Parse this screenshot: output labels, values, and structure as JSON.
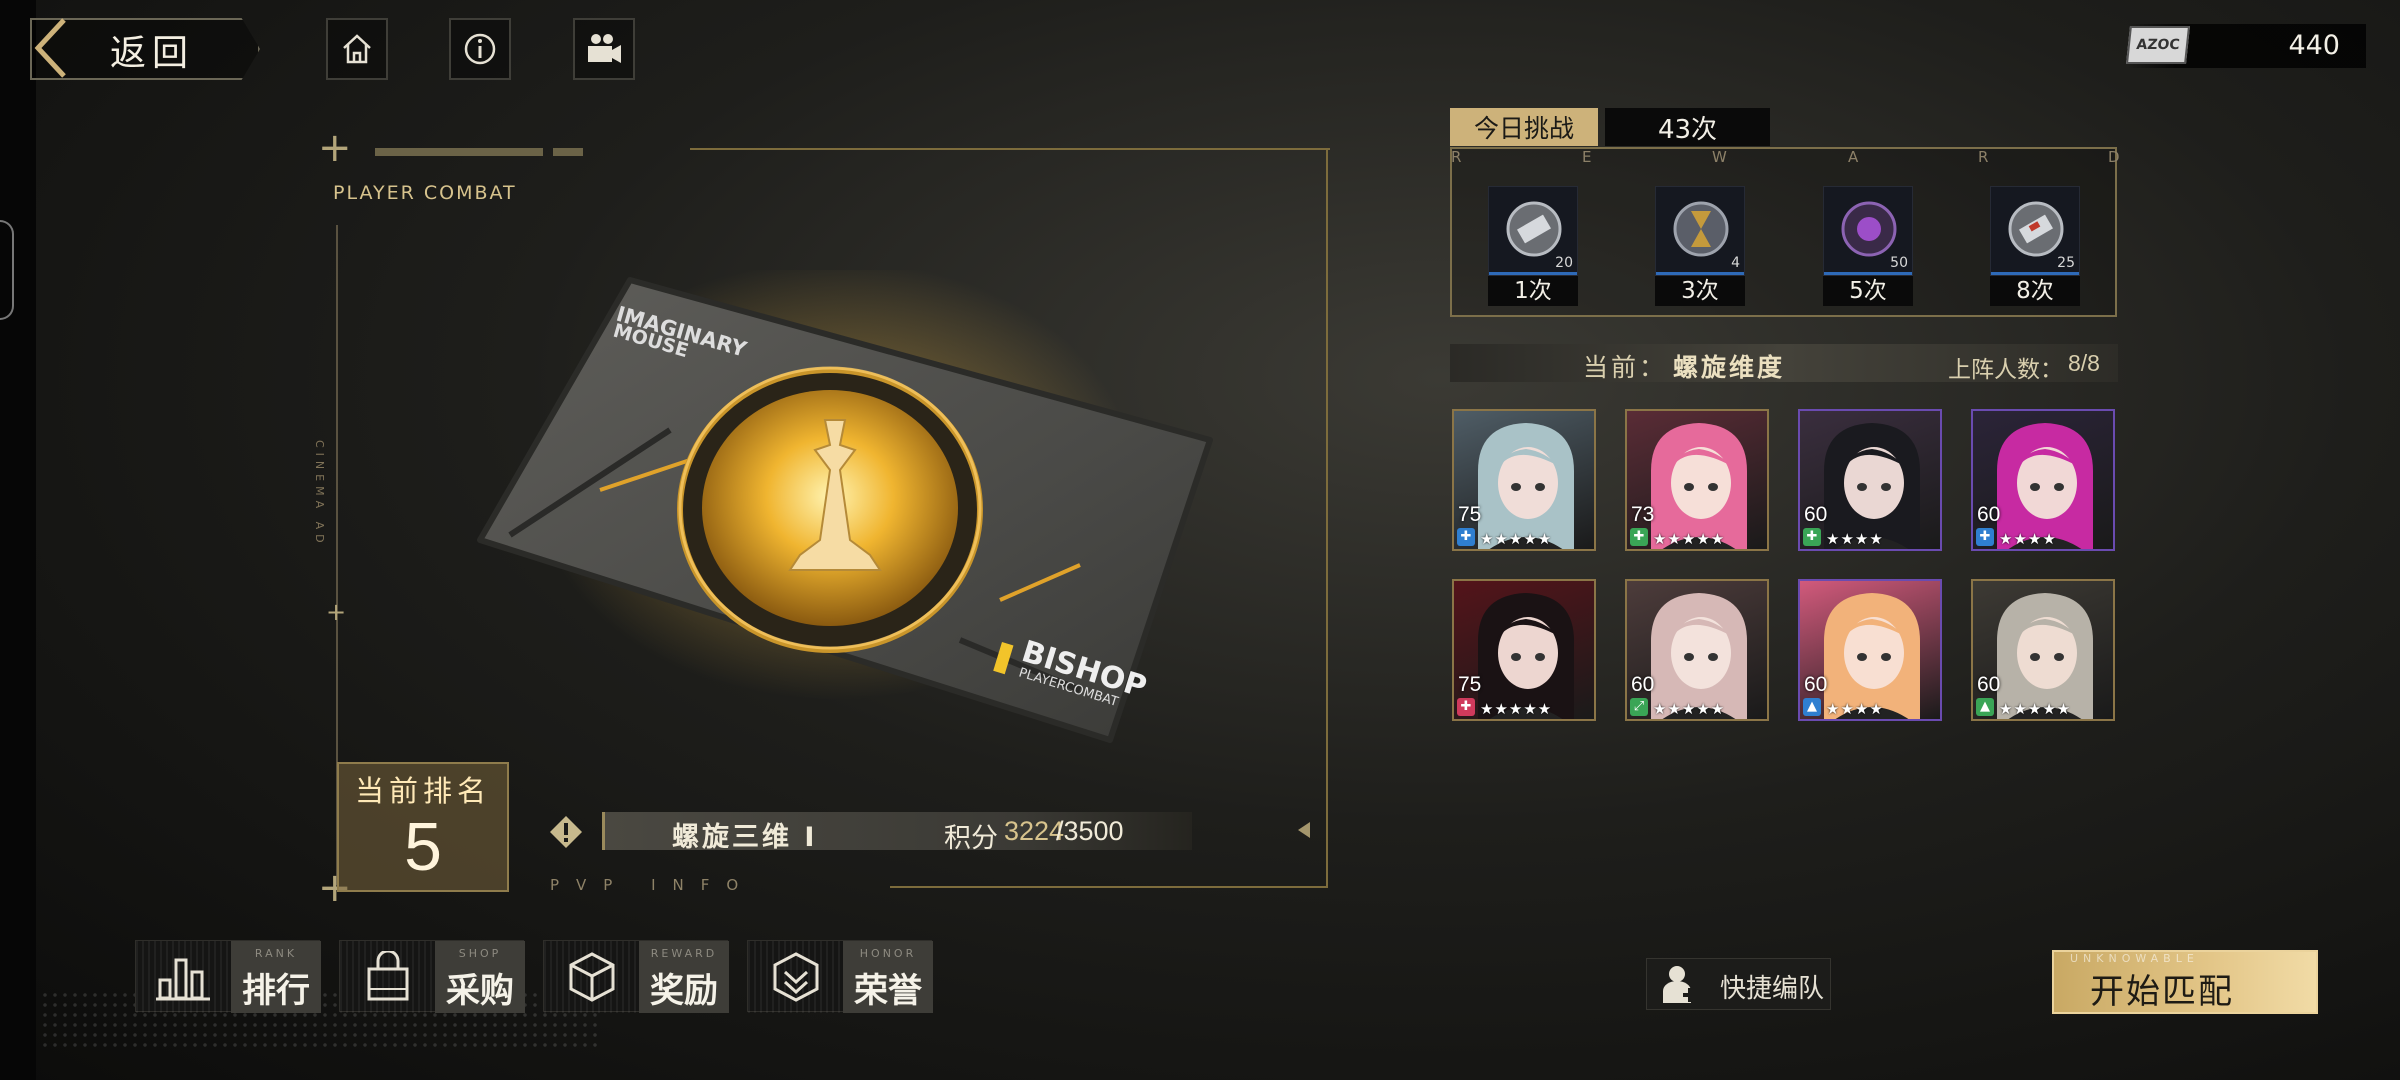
{
  "topbar": {
    "back_label": "返回",
    "currency": {
      "icon_text": "AZOC",
      "value": "440"
    }
  },
  "card": {
    "player_combat_label": "PLAYER COMBAT",
    "cinema_label": "CINEMA AD",
    "brand_line1": "IMAGINARY",
    "brand_line2": "MOUSE",
    "rank_name": "BISHOP",
    "rank_sub": "PLAYERCOMBAT"
  },
  "ranking": {
    "title": "当前排名",
    "value": "5"
  },
  "season": {
    "name": "螺旋三维 I",
    "score_label": "积分",
    "score_current": "3224",
    "score_max": "/3500"
  },
  "pvp_info_label": "PVP INFO",
  "bottom_nav": [
    {
      "en": "RANK",
      "cn": "排行",
      "icon": "bar-chart-icon"
    },
    {
      "en": "SHOP",
      "cn": "采购",
      "icon": "shopping-bag-icon"
    },
    {
      "en": "REWARD",
      "cn": "奖励",
      "icon": "cube-icon"
    },
    {
      "en": "HONOR",
      "cn": "荣誉",
      "icon": "chevron-badge-icon"
    }
  ],
  "challenge": {
    "today_label": "今日挑战",
    "count": "43次",
    "reward_letters": [
      "R",
      "E",
      "W",
      "A",
      "R",
      "D"
    ],
    "rewards": [
      {
        "qty": "20",
        "label": "1次",
        "color": "#9aa0a8"
      },
      {
        "qty": "4",
        "label": "3次",
        "color": "#b08a3c"
      },
      {
        "qty": "50",
        "label": "5次",
        "color": "#8a4aa8"
      },
      {
        "qty": "25",
        "label": "8次",
        "color": "#a0a0a0"
      }
    ]
  },
  "current": {
    "label": "当前：",
    "name": "螺旋维度",
    "team_label": "上阵人数：",
    "team_count": "8/8"
  },
  "characters": [
    {
      "level": "75",
      "stars": "★★★★★",
      "class_color": "#2f7fd0",
      "class_glyph": "✚",
      "hair": "#a9c2c7",
      "skin": "#f0ddd8",
      "bg": "#4f5d66",
      "frame": "gold"
    },
    {
      "level": "73",
      "stars": "★★★★★",
      "class_color": "#3aa556",
      "class_glyph": "✚",
      "hair": "#e66a9b",
      "skin": "#f6dfd8",
      "bg": "#5a2c36",
      "frame": "gold"
    },
    {
      "level": "60",
      "stars": "★★★★",
      "class_color": "#3aa556",
      "class_glyph": "✚",
      "hair": "#1a1a1f",
      "skin": "#ead7d3",
      "bg": "#3a2e3e",
      "frame": "purple"
    },
    {
      "level": "60",
      "stars": "★★★★",
      "class_color": "#2f7fd0",
      "class_glyph": "✚",
      "hair": "#c72aa2",
      "skin": "#f1d8d6",
      "bg": "#2b2438",
      "frame": "purple"
    },
    {
      "level": "75",
      "stars": "★★★★★",
      "class_color": "#d03a5c",
      "class_glyph": "✚",
      "hair": "#1a1214",
      "skin": "#edd6d0",
      "bg": "#54141a",
      "frame": "gold"
    },
    {
      "level": "60",
      "stars": "★★★★★",
      "class_color": "#3aa556",
      "class_glyph": "⤢",
      "hair": "#d6b8b6",
      "skin": "#f3e2dc",
      "bg": "#4d3c3b",
      "frame": "gold"
    },
    {
      "level": "60",
      "stars": "★★★★",
      "class_color": "#2f7fd0",
      "class_glyph": "▲",
      "hair": "#f2b27a",
      "skin": "#f8dfd2",
      "bg": "#d25a7c",
      "frame": "purple"
    },
    {
      "level": "60",
      "stars": "★★★★★",
      "class_color": "#3aa556",
      "class_glyph": "▲",
      "hair": "#b7b2a8",
      "skin": "#eedcd2",
      "bg": "#3d3a34",
      "frame": "gold"
    }
  ],
  "actions": {
    "quick_team_label": "快捷编队",
    "start_en": "UNKNOWABLE",
    "start_label": "开始匹配"
  }
}
